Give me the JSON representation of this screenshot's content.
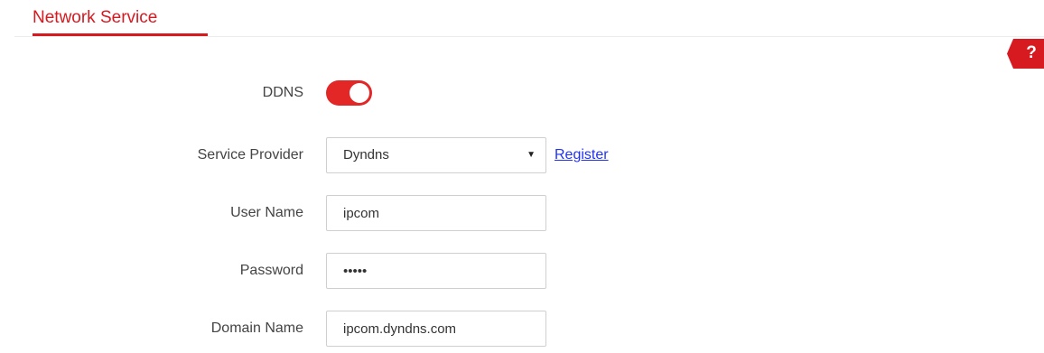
{
  "header": {
    "title": "Network Service"
  },
  "help": {
    "label": "?",
    "icon": "help-icon",
    "color": "#d71920"
  },
  "ddns": {
    "label": "DDNS",
    "enabled": true,
    "color": "#e32626"
  },
  "service_provider": {
    "label": "Service Provider",
    "selected": "Dyndns",
    "arrow": "▼",
    "register_link": "Register"
  },
  "user_name": {
    "label": "User Name",
    "value": "ipcom"
  },
  "password": {
    "label": "Password",
    "value": "•••••"
  },
  "domain_name": {
    "label": "Domain Name",
    "value": "ipcom.dyndns.com"
  }
}
